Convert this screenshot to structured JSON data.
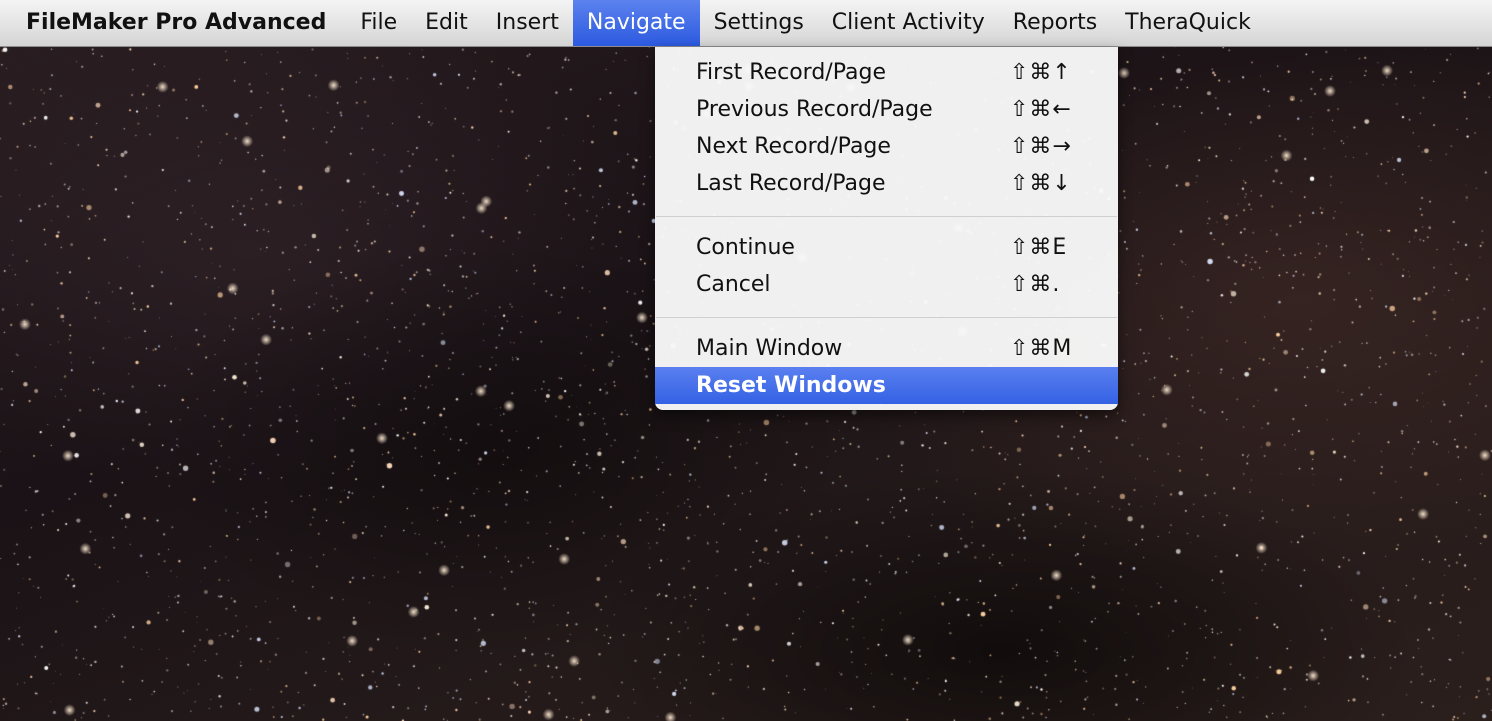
{
  "menubar": {
    "app_name": "FileMaker Pro Advanced",
    "items": [
      {
        "label": "File"
      },
      {
        "label": "Edit"
      },
      {
        "label": "Insert"
      },
      {
        "label": "Navigate"
      },
      {
        "label": "Settings"
      },
      {
        "label": "Client Activity"
      },
      {
        "label": "Reports"
      },
      {
        "label": "TheraQuick"
      }
    ],
    "active_item": "Navigate"
  },
  "navigate_menu": {
    "groups": [
      [
        {
          "label": "First Record/Page",
          "shortcut": "⇧⌘↑"
        },
        {
          "label": "Previous Record/Page",
          "shortcut": "⇧⌘←"
        },
        {
          "label": "Next Record/Page",
          "shortcut": "⇧⌘→"
        },
        {
          "label": "Last Record/Page",
          "shortcut": "⇧⌘↓"
        }
      ],
      [
        {
          "label": "Continue",
          "shortcut": "⇧⌘E"
        },
        {
          "label": "Cancel",
          "shortcut": "⇧⌘."
        }
      ],
      [
        {
          "label": "Main Window",
          "shortcut": "⇧⌘M"
        },
        {
          "label": "Reset Windows",
          "shortcut": ""
        }
      ]
    ],
    "highlighted_item": "Reset Windows"
  },
  "desktop": {
    "wallpaper": "starfield",
    "colors": {
      "highlight": "#3462e4",
      "menubar": "#e6e6e6"
    }
  }
}
